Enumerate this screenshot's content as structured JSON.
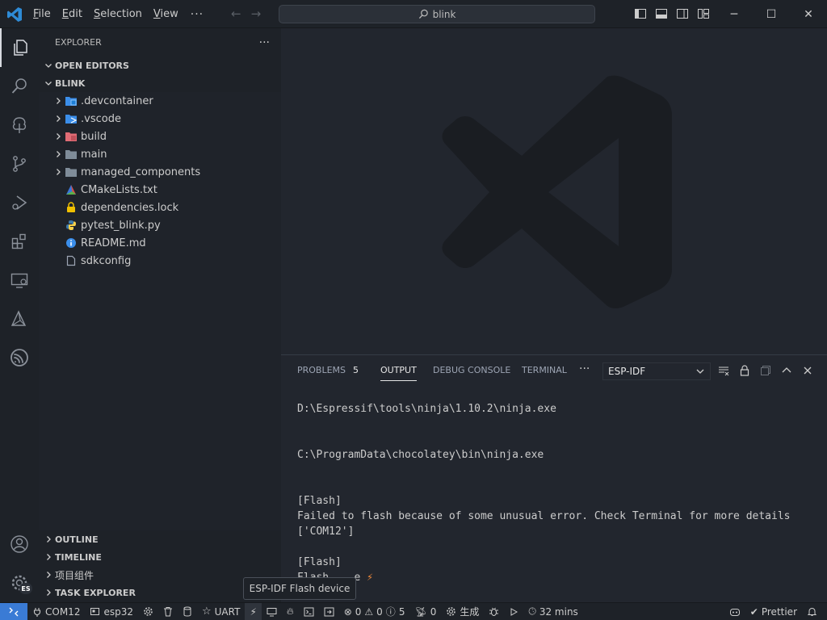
{
  "titlebar": {
    "menu": [
      {
        "label": "File",
        "key": "F",
        "rest": "ile"
      },
      {
        "label": "Edit",
        "key": "E",
        "rest": "dit"
      },
      {
        "label": "Selection",
        "key": "S",
        "rest": "election"
      },
      {
        "label": "View",
        "key": "V",
        "rest": "iew"
      }
    ],
    "more": "···",
    "search": "blink"
  },
  "sidebar": {
    "title": "EXPLORER",
    "more": "···",
    "open_editors": "OPEN EDITORS",
    "project": "BLINK",
    "items": [
      {
        "name": ".devcontainer",
        "type": "folder",
        "icon": "devcontainer-folder-icon",
        "color": "#3b8eea"
      },
      {
        "name": ".vscode",
        "type": "folder",
        "icon": "vscode-folder-icon",
        "color": "#3b8eea"
      },
      {
        "name": "build",
        "type": "folder",
        "icon": "build-folder-icon",
        "color": "#e06c75"
      },
      {
        "name": "main",
        "type": "folder",
        "icon": "folder-icon",
        "color": "#7f8c99"
      },
      {
        "name": "managed_components",
        "type": "folder",
        "icon": "folder-icon",
        "color": "#7f8c99"
      },
      {
        "name": "CMakeLists.txt",
        "type": "file",
        "icon": "cmake-icon"
      },
      {
        "name": "dependencies.lock",
        "type": "file",
        "icon": "lock-icon"
      },
      {
        "name": "pytest_blink.py",
        "type": "file",
        "icon": "python-icon"
      },
      {
        "name": "README.md",
        "type": "file",
        "icon": "info-icon"
      },
      {
        "name": "sdkconfig",
        "type": "file",
        "icon": "file-icon"
      }
    ],
    "outline": "OUTLINE",
    "timeline": "TIMELINE",
    "components": "项目组件",
    "task_explorer": "TASK EXPLORER"
  },
  "panel": {
    "tabs": {
      "problems": "PROBLEMS",
      "problems_count": "5",
      "output": "OUTPUT",
      "debug_console": "DEBUG CONSOLE",
      "terminal": "TERMINAL",
      "more": "···"
    },
    "channel": "ESP-IDF",
    "lines": [
      "",
      "D:\\Espressif\\tools\\ninja\\1.10.2\\ninja.exe",
      "",
      "",
      "C:\\ProgramData\\chocolatey\\bin\\ninja.exe",
      "",
      "",
      "[Flash]",
      "Failed to flash because of some unusual error. Check Terminal for more details",
      "['COM12']",
      "",
      "[Flash]",
      "Flash    e"
    ]
  },
  "tooltip": "ESP-IDF Flash device",
  "statusbar": {
    "port": "COM12",
    "target": "esp32",
    "flash_method": "UART",
    "errors": "0",
    "warnings": "0",
    "infos": "5",
    "ports": "0",
    "build": "生成",
    "time": "32 mins",
    "prettier": "Prettier"
  },
  "activity": {
    "badge": "ES"
  }
}
